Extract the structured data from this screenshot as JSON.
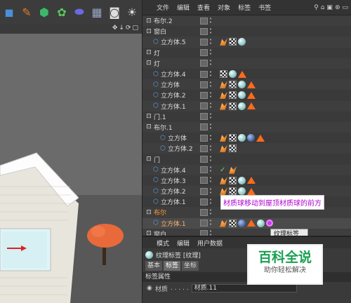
{
  "toolbar": {
    "icons": [
      "cube-icon",
      "pen-icon",
      "subdivide-icon",
      "array-icon",
      "deformer-icon",
      "floor-icon",
      "camera-icon",
      "light-icon"
    ]
  },
  "viewport": {
    "nav_icons": "✥↓⟳▢"
  },
  "om": {
    "menu": [
      "文件",
      "编辑",
      "查看",
      "对象",
      "标签",
      "书签"
    ],
    "rows": [
      {
        "label": "布尔.2",
        "indent": 0,
        "icon": "null",
        "tags": []
      },
      {
        "label": "窗白",
        "indent": 0,
        "icon": "null",
        "tags": []
      },
      {
        "label": "立方体.5",
        "indent": 1,
        "icon": "cube",
        "tags": [
          "phong",
          "checker",
          "mat"
        ]
      },
      {
        "label": "灯",
        "indent": 0,
        "icon": "null",
        "tags": []
      },
      {
        "label": "灯",
        "indent": 0,
        "icon": "null",
        "tags": []
      },
      {
        "label": "立方体.4",
        "indent": 1,
        "icon": "cube",
        "tags": [
          "checker",
          "mat",
          "tri"
        ]
      },
      {
        "label": "立方体",
        "indent": 1,
        "icon": "cube",
        "tags": [
          "phong",
          "checker",
          "mat",
          "tri"
        ]
      },
      {
        "label": "立方体.2",
        "indent": 1,
        "icon": "cube",
        "tags": [
          "phong",
          "checker",
          "mat",
          "tri"
        ]
      },
      {
        "label": "立方体.1",
        "indent": 1,
        "icon": "cube",
        "tags": [
          "phong",
          "checker",
          "mat",
          "tri"
        ]
      },
      {
        "label": "门.1",
        "indent": 0,
        "icon": "null",
        "tags": []
      },
      {
        "label": "布尔.1",
        "indent": 0,
        "icon": "null",
        "tags": []
      },
      {
        "label": "立方体",
        "indent": 2,
        "icon": "cube",
        "tags": [
          "phong",
          "checker",
          "mat",
          "matd",
          "tri"
        ]
      },
      {
        "label": "立方体.2",
        "indent": 2,
        "icon": "cube",
        "tags": [
          "phong",
          "checker"
        ]
      },
      {
        "label": "门",
        "indent": 0,
        "icon": "null",
        "tags": []
      },
      {
        "label": "立方体.4",
        "indent": 1,
        "icon": "cube",
        "tags": [
          "check",
          "phong"
        ]
      },
      {
        "label": "立方体.3",
        "indent": 1,
        "icon": "cube",
        "tags": [
          "phong",
          "checker",
          "mat",
          "tri"
        ]
      },
      {
        "label": "立方体.2",
        "indent": 1,
        "icon": "cube",
        "tags": [
          "phong",
          "checker",
          "mat",
          "tri"
        ]
      },
      {
        "label": "立方体.1",
        "indent": 1,
        "icon": "cube",
        "tags": [
          "check",
          "phong"
        ]
      },
      {
        "label": "布尔",
        "indent": 0,
        "icon": "null",
        "tags": [],
        "orange": true
      },
      {
        "label": "立方体.1",
        "indent": 1,
        "icon": "cube",
        "tags": [
          "phong",
          "checker",
          "matd",
          "tri",
          "mat",
          "pink"
        ],
        "selected": true
      },
      {
        "label": "窗白",
        "indent": 0,
        "icon": "null",
        "tags": []
      }
    ],
    "callout": "材质球移动到屋顶材质球的前方",
    "tooltip": "纹理标签\n立方体.1..."
  },
  "attr": {
    "menu": [
      "模式",
      "编辑",
      "用户数据"
    ],
    "title": "纹理标签 [纹理]",
    "tabs": [
      "基本",
      "标签",
      "坐标"
    ],
    "active_tab": "标签",
    "section": "标签属性",
    "field_label": "材质",
    "field_value": "材质.11"
  },
  "watermark": {
    "title": "百科全说",
    "subtitle": "助你轻松解决"
  }
}
